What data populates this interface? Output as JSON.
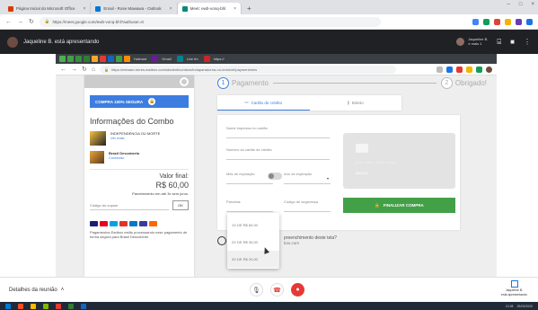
{
  "outer_browser": {
    "tabs": [
      {
        "label": "Página Inicial do Microsoft Office",
        "favicon_color": "#d83b01",
        "active": false
      },
      {
        "label": "Email - Rose Mawawa - Outlook",
        "favicon_color": "#0078d4",
        "active": false
      },
      {
        "label": "Meet: ewb-vonq-bhl",
        "favicon_color": "#00897b",
        "active": true
      }
    ],
    "url": "https://meet.google.com/ewb-vonq-bhl?authuser=0",
    "extension_colors": [
      "#4285f4",
      "#0f9d58",
      "#db4437",
      "#f4b400",
      "#673ab7",
      "#1a73e8"
    ]
  },
  "meet_presenting": {
    "title": "Jaqueline B. está apresentando",
    "user_name": "Jaqueline B.",
    "user_sub": "e mais 1"
  },
  "shared_screen": {
    "bookmark_colors": [
      "#4caf50",
      "#43a047",
      "#388e3c",
      "#2e7d32",
      "#f9a825",
      "#e53935",
      "#1565c0",
      "#43a047",
      "#fb8c00",
      "#6a1b9a",
      "#00838f",
      "#c62828"
    ],
    "bookmark_labels": [
      "Hotmart",
      "Gmail",
      "Live fm",
      "https://"
    ],
    "url": "https://reimam-torres.eadbox.com/student/combos/indaparadorna-no-invisivel/payment/new",
    "steps": [
      {
        "number": "1",
        "label": "Pagamento"
      },
      {
        "number": "2",
        "label": "Obrigado!"
      }
    ],
    "left": {
      "secure_label": "COMPRA 100% SEGURA",
      "combo_title": "Informações do Combo",
      "products": [
        {
          "name": "INDEPENDENCIA OU MORTE",
          "sub": "Ver mais"
        },
        {
          "name": "Brasil Descoberto",
          "sub": "Conteúdo"
        }
      ],
      "total_label": "Valor final:",
      "total_value": "R$ 60,00",
      "installments": "Parcelamento em até 3x sem juros.",
      "coupon_placeholder": "Código do cupom",
      "ok_label": "OK",
      "brand_colors": [
        "#1a1f71",
        "#eb001b",
        "#00a4e0",
        "#e4322b",
        "#007ac2",
        "#3b3b98",
        "#ff6600"
      ],
      "eadbox_text": "Pagamentos Eadbox estão processando esse pagamento de forma segura para Brasil Descoberto"
    },
    "pay_tabs": [
      {
        "label": "Cartão de crédito",
        "active": true,
        "icon": "credit-card-icon"
      },
      {
        "label": "Boleto",
        "active": false,
        "icon": "barcode-icon"
      }
    ],
    "form": {
      "name_label": "Nome impresso no cartão",
      "number_label": "Número do cartão de crédito",
      "month_label": "Mês de expiração",
      "year_label": "Ano de expiração",
      "installments_label": "Parcelas",
      "cvv_label": "Código de segurança",
      "card_number_placeholder": "•••• •••• •••• ••••",
      "card_expiry_placeholder": "MM/AA",
      "finish_label": "FINALIZAR COMPRA"
    },
    "installment_options": [
      "1X DE R$ 60,00",
      "2X DE R$ 30,00",
      "3X DE R$ 20,00"
    ],
    "help_text": "preenchimento deste tela?",
    "help_sub": "box.com"
  },
  "meet_bottom": {
    "details_label": "Detalhes da reunião",
    "presenting_name": "Jaqueline B.",
    "presenting_sub": "está apresentando"
  },
  "taskbar": {
    "icon_colors": [
      "#0078d4",
      "#f25022",
      "#ffb900",
      "#7fba00",
      "#e53935",
      "#2e7d32",
      "#1565c0"
    ],
    "time": "13:28",
    "date": "25/03/2020"
  }
}
